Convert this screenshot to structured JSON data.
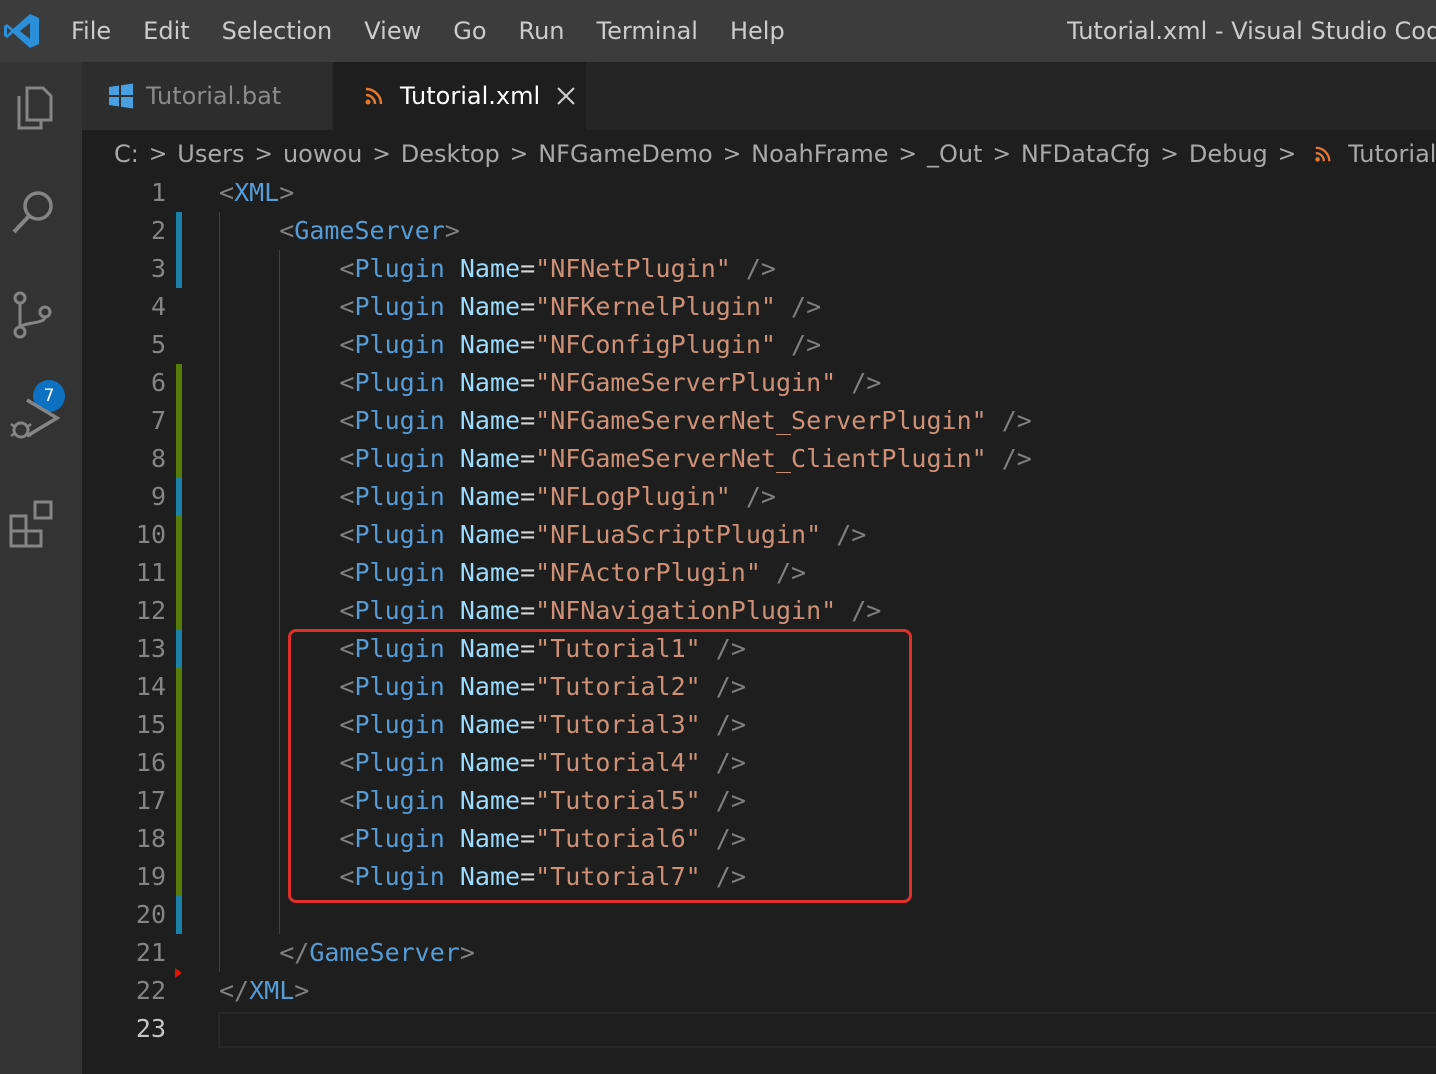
{
  "menu": [
    "File",
    "Edit",
    "Selection",
    "View",
    "Go",
    "Run",
    "Terminal",
    "Help"
  ],
  "window_title": "Tutorial.xml - Visual Studio Code",
  "activity": {
    "source_control_badge": "7"
  },
  "tabs": [
    {
      "label": "Tutorial.bat",
      "active": false
    },
    {
      "label": "Tutorial.xml",
      "active": true
    }
  ],
  "breadcrumb": [
    "C:",
    "Users",
    "uowou",
    "Desktop",
    "NFGameDemo",
    "NoahFrame",
    "_Out",
    "NFDataCfg",
    "Debug",
    "Tutorial.xml"
  ],
  "editor": {
    "lines": [
      {
        "n": "1",
        "tokens": [
          [
            "p",
            "<"
          ],
          [
            "t",
            "XML"
          ],
          [
            "p",
            ">"
          ]
        ]
      },
      {
        "n": "2",
        "tokens": [
          [
            "o",
            "    "
          ],
          [
            "p",
            "<"
          ],
          [
            "t",
            "GameServer"
          ],
          [
            "p",
            ">"
          ]
        ]
      },
      {
        "n": "3",
        "tokens": [
          [
            "o",
            "        "
          ],
          [
            "p",
            "<"
          ],
          [
            "t",
            "Plugin"
          ],
          [
            "o",
            " "
          ],
          [
            "a",
            "Name"
          ],
          [
            "o",
            "="
          ],
          [
            "s",
            "\"NFNetPlugin\""
          ],
          [
            "o",
            " "
          ],
          [
            "p",
            "/>"
          ]
        ]
      },
      {
        "n": "4",
        "tokens": [
          [
            "o",
            "        "
          ],
          [
            "p",
            "<"
          ],
          [
            "t",
            "Plugin"
          ],
          [
            "o",
            " "
          ],
          [
            "a",
            "Name"
          ],
          [
            "o",
            "="
          ],
          [
            "s",
            "\"NFKernelPlugin\""
          ],
          [
            "o",
            " "
          ],
          [
            "p",
            "/>"
          ]
        ]
      },
      {
        "n": "5",
        "tokens": [
          [
            "o",
            "        "
          ],
          [
            "p",
            "<"
          ],
          [
            "t",
            "Plugin"
          ],
          [
            "o",
            " "
          ],
          [
            "a",
            "Name"
          ],
          [
            "o",
            "="
          ],
          [
            "s",
            "\"NFConfigPlugin\""
          ],
          [
            "o",
            " "
          ],
          [
            "p",
            "/>"
          ]
        ]
      },
      {
        "n": "6",
        "tokens": [
          [
            "o",
            "        "
          ],
          [
            "p",
            "<"
          ],
          [
            "t",
            "Plugin"
          ],
          [
            "o",
            " "
          ],
          [
            "a",
            "Name"
          ],
          [
            "o",
            "="
          ],
          [
            "s",
            "\"NFGameServerPlugin\""
          ],
          [
            "o",
            " "
          ],
          [
            "p",
            "/>"
          ]
        ]
      },
      {
        "n": "7",
        "tokens": [
          [
            "o",
            "        "
          ],
          [
            "p",
            "<"
          ],
          [
            "t",
            "Plugin"
          ],
          [
            "o",
            " "
          ],
          [
            "a",
            "Name"
          ],
          [
            "o",
            "="
          ],
          [
            "s",
            "\"NFGameServerNet_ServerPlugin\""
          ],
          [
            "o",
            " "
          ],
          [
            "p",
            "/>"
          ]
        ]
      },
      {
        "n": "8",
        "tokens": [
          [
            "o",
            "        "
          ],
          [
            "p",
            "<"
          ],
          [
            "t",
            "Plugin"
          ],
          [
            "o",
            " "
          ],
          [
            "a",
            "Name"
          ],
          [
            "o",
            "="
          ],
          [
            "s",
            "\"NFGameServerNet_ClientPlugin\""
          ],
          [
            "o",
            " "
          ],
          [
            "p",
            "/>"
          ]
        ]
      },
      {
        "n": "9",
        "tokens": [
          [
            "o",
            "        "
          ],
          [
            "p",
            "<"
          ],
          [
            "t",
            "Plugin"
          ],
          [
            "o",
            " "
          ],
          [
            "a",
            "Name"
          ],
          [
            "o",
            "="
          ],
          [
            "s",
            "\"NFLogPlugin\""
          ],
          [
            "o",
            " "
          ],
          [
            "p",
            "/>"
          ]
        ]
      },
      {
        "n": "10",
        "tokens": [
          [
            "o",
            "        "
          ],
          [
            "p",
            "<"
          ],
          [
            "t",
            "Plugin"
          ],
          [
            "o",
            " "
          ],
          [
            "a",
            "Name"
          ],
          [
            "o",
            "="
          ],
          [
            "s",
            "\"NFLuaScriptPlugin\""
          ],
          [
            "o",
            " "
          ],
          [
            "p",
            "/>"
          ]
        ]
      },
      {
        "n": "11",
        "tokens": [
          [
            "o",
            "        "
          ],
          [
            "p",
            "<"
          ],
          [
            "t",
            "Plugin"
          ],
          [
            "o",
            " "
          ],
          [
            "a",
            "Name"
          ],
          [
            "o",
            "="
          ],
          [
            "s",
            "\"NFActorPlugin\""
          ],
          [
            "o",
            " "
          ],
          [
            "p",
            "/>"
          ]
        ]
      },
      {
        "n": "12",
        "tokens": [
          [
            "o",
            "        "
          ],
          [
            "p",
            "<"
          ],
          [
            "t",
            "Plugin"
          ],
          [
            "o",
            " "
          ],
          [
            "a",
            "Name"
          ],
          [
            "o",
            "="
          ],
          [
            "s",
            "\"NFNavigationPlugin\""
          ],
          [
            "o",
            " "
          ],
          [
            "p",
            "/>"
          ]
        ]
      },
      {
        "n": "13",
        "tokens": [
          [
            "o",
            "        "
          ],
          [
            "p",
            "<"
          ],
          [
            "t",
            "Plugin"
          ],
          [
            "o",
            " "
          ],
          [
            "a",
            "Name"
          ],
          [
            "o",
            "="
          ],
          [
            "s",
            "\"Tutorial1\""
          ],
          [
            "o",
            " "
          ],
          [
            "p",
            "/>"
          ]
        ]
      },
      {
        "n": "14",
        "tokens": [
          [
            "o",
            "        "
          ],
          [
            "p",
            "<"
          ],
          [
            "t",
            "Plugin"
          ],
          [
            "o",
            " "
          ],
          [
            "a",
            "Name"
          ],
          [
            "o",
            "="
          ],
          [
            "s",
            "\"Tutorial2\""
          ],
          [
            "o",
            " "
          ],
          [
            "p",
            "/>"
          ]
        ]
      },
      {
        "n": "15",
        "tokens": [
          [
            "o",
            "        "
          ],
          [
            "p",
            "<"
          ],
          [
            "t",
            "Plugin"
          ],
          [
            "o",
            " "
          ],
          [
            "a",
            "Name"
          ],
          [
            "o",
            "="
          ],
          [
            "s",
            "\"Tutorial3\""
          ],
          [
            "o",
            " "
          ],
          [
            "p",
            "/>"
          ]
        ]
      },
      {
        "n": "16",
        "tokens": [
          [
            "o",
            "        "
          ],
          [
            "p",
            "<"
          ],
          [
            "t",
            "Plugin"
          ],
          [
            "o",
            " "
          ],
          [
            "a",
            "Name"
          ],
          [
            "o",
            "="
          ],
          [
            "s",
            "\"Tutorial4\""
          ],
          [
            "o",
            " "
          ],
          [
            "p",
            "/>"
          ]
        ]
      },
      {
        "n": "17",
        "tokens": [
          [
            "o",
            "        "
          ],
          [
            "p",
            "<"
          ],
          [
            "t",
            "Plugin"
          ],
          [
            "o",
            " "
          ],
          [
            "a",
            "Name"
          ],
          [
            "o",
            "="
          ],
          [
            "s",
            "\"Tutorial5\""
          ],
          [
            "o",
            " "
          ],
          [
            "p",
            "/>"
          ]
        ]
      },
      {
        "n": "18",
        "tokens": [
          [
            "o",
            "        "
          ],
          [
            "p",
            "<"
          ],
          [
            "t",
            "Plugin"
          ],
          [
            "o",
            " "
          ],
          [
            "a",
            "Name"
          ],
          [
            "o",
            "="
          ],
          [
            "s",
            "\"Tutorial6\""
          ],
          [
            "o",
            " "
          ],
          [
            "p",
            "/>"
          ]
        ]
      },
      {
        "n": "19",
        "tokens": [
          [
            "o",
            "        "
          ],
          [
            "p",
            "<"
          ],
          [
            "t",
            "Plugin"
          ],
          [
            "o",
            " "
          ],
          [
            "a",
            "Name"
          ],
          [
            "o",
            "="
          ],
          [
            "s",
            "\"Tutorial7\""
          ],
          [
            "o",
            " "
          ],
          [
            "p",
            "/>"
          ]
        ]
      },
      {
        "n": "20",
        "tokens": []
      },
      {
        "n": "21",
        "tokens": [
          [
            "o",
            "    "
          ],
          [
            "p",
            "</"
          ],
          [
            "t",
            "GameServer"
          ],
          [
            "p",
            ">"
          ]
        ]
      },
      {
        "n": "22",
        "tokens": [
          [
            "p",
            "</"
          ],
          [
            "t",
            "XML"
          ],
          [
            "p",
            ">"
          ]
        ]
      },
      {
        "n": "23",
        "tokens": []
      }
    ],
    "gutter_marks": [
      {
        "line": 2,
        "kind": "modified"
      },
      {
        "line": 3,
        "kind": "modified"
      },
      {
        "line": 6,
        "kind": "added"
      },
      {
        "line": 7,
        "kind": "added"
      },
      {
        "line": 8,
        "kind": "added"
      },
      {
        "line": 9,
        "kind": "modified"
      },
      {
        "line": 10,
        "kind": "added"
      },
      {
        "line": 11,
        "kind": "added"
      },
      {
        "line": 12,
        "kind": "added"
      },
      {
        "line": 13,
        "kind": "modified"
      },
      {
        "line": 14,
        "kind": "added"
      },
      {
        "line": 15,
        "kind": "added"
      },
      {
        "line": 16,
        "kind": "added"
      },
      {
        "line": 17,
        "kind": "added"
      },
      {
        "line": 18,
        "kind": "added"
      },
      {
        "line": 19,
        "kind": "added"
      },
      {
        "line": 20,
        "kind": "modified"
      }
    ],
    "colors": {
      "added": "#587c0c",
      "modified": "#1b81a8",
      "highlight": "#e0302a"
    }
  }
}
